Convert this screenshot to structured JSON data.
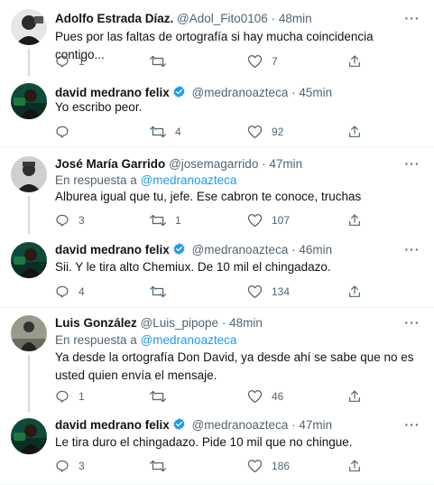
{
  "colors": {
    "link": "#1d9bf0",
    "muted": "#536471",
    "text": "#0f1419",
    "verified": "#1d9bf0"
  },
  "tweets": [
    {
      "name": "Adolfo Estrada Díaz.",
      "handle": "@Adol_Fito0106",
      "dot": "·",
      "time": "48min",
      "verified": false,
      "reply_prefix": "",
      "reply_mention": "",
      "text": "Pues por las faltas de ortografía si hay mucha coincidencia contigo...",
      "replies": "1",
      "retweets": "",
      "likes": "7"
    },
    {
      "name": "david medrano felix",
      "handle": "@medranoazteca",
      "dot": "·",
      "time": "45min",
      "verified": true,
      "reply_prefix": "",
      "reply_mention": "",
      "text": "Yo escribo peor.",
      "replies": "",
      "retweets": "4",
      "likes": "92"
    },
    {
      "name": "José María Garrido",
      "handle": "@josemagarrido",
      "dot": "·",
      "time": "47min",
      "verified": false,
      "reply_prefix": "En respuesta a",
      "reply_mention": "@medranoazteca",
      "text": "Alburea igual que tu, jefe. Ese cabron te conoce, truchas",
      "replies": "3",
      "retweets": "1",
      "likes": "107"
    },
    {
      "name": "david medrano felix",
      "handle": "@medranoazteca",
      "dot": "·",
      "time": "46min",
      "verified": true,
      "reply_prefix": "",
      "reply_mention": "",
      "text": "Sii. Y le tira alto Chemiux. De 10 mil el chingadazo.",
      "replies": "4",
      "retweets": "",
      "likes": "134"
    },
    {
      "name": "Luis González",
      "handle": "@Luis_pipope",
      "dot": "·",
      "time": "48min",
      "verified": false,
      "reply_prefix": "En respuesta a",
      "reply_mention": "@medranoazteca",
      "text": "Ya desde la ortografía Don David, ya desde ahí se sabe que no es usted quien envía el mensaje.",
      "replies": "1",
      "retweets": "",
      "likes": "46"
    },
    {
      "name": "david medrano felix",
      "handle": "@medranoazteca",
      "dot": "·",
      "time": "47min",
      "verified": true,
      "reply_prefix": "",
      "reply_mention": "",
      "text": "Le tira duro el chingadazo. Pide 10 mil que no chingue.",
      "replies": "3",
      "retweets": "",
      "likes": "186"
    }
  ]
}
